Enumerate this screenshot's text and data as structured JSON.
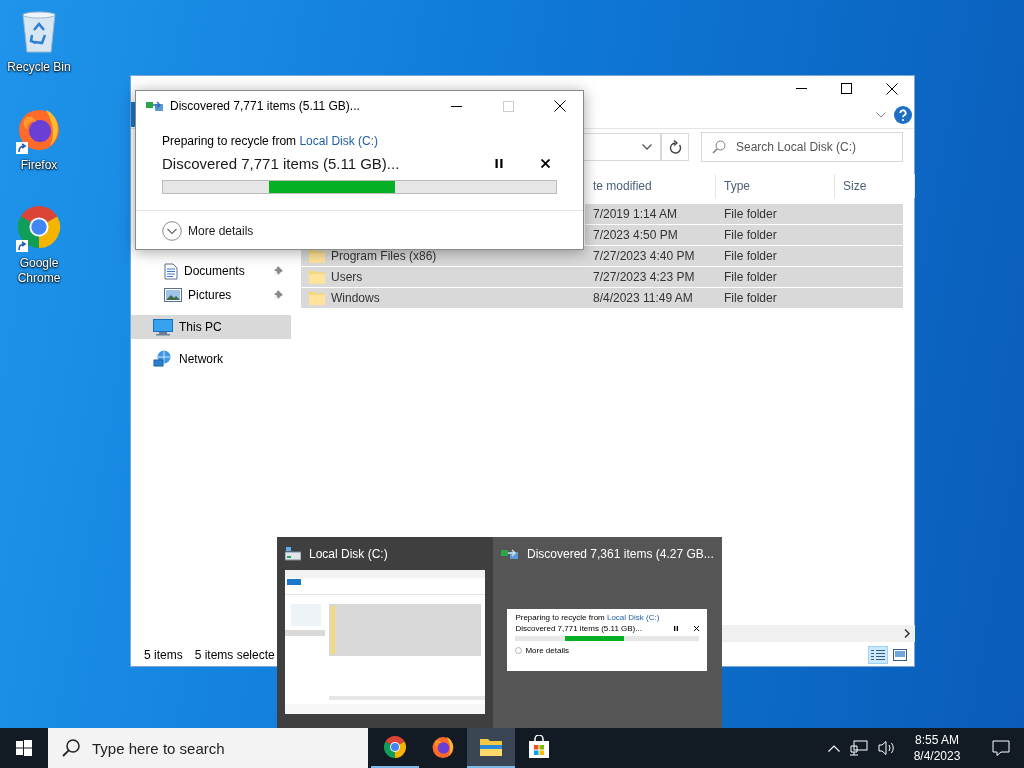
{
  "desktop_icons": [
    {
      "label": "Recycle Bin",
      "kind": "recycle"
    },
    {
      "label": "Firefox",
      "kind": "firefox"
    },
    {
      "label": "Google Chrome",
      "kind": "chrome"
    }
  ],
  "explorer": {
    "search": {
      "placeholder": "Search Local Disk (C:)"
    },
    "nav": [
      {
        "label": "Documents",
        "kind": "documents",
        "pinned": true,
        "selected": false
      },
      {
        "label": "Pictures",
        "kind": "pictures",
        "pinned": true,
        "selected": false
      },
      {
        "label": "This PC",
        "kind": "pc",
        "pinned": false,
        "selected": true
      },
      {
        "label": "Network",
        "kind": "network",
        "pinned": false,
        "selected": false
      }
    ],
    "columns": [
      "te modified",
      "Type",
      "Size"
    ],
    "rows": [
      {
        "date": "7/2019 1:14 AM",
        "type": "File folder",
        "selected": true
      },
      {
        "date": "7/2023 4:50 PM",
        "type": "File folder",
        "selected": true
      },
      {
        "name": "Program Files (x86)",
        "date": "7/27/2023 4:40 PM",
        "type": "File folder",
        "selected": true
      },
      {
        "name": "Users",
        "date": "7/27/2023 4:23 PM",
        "type": "File folder",
        "selected": true
      },
      {
        "name": "Windows",
        "date": "8/4/2023 11:49 AM",
        "type": "File folder",
        "selected": true
      }
    ],
    "status_bar": [
      "5 items",
      "5 items selecte"
    ],
    "view_buttons": [
      {
        "kind": "details",
        "selected": true
      },
      {
        "kind": "tiles",
        "selected": false
      }
    ]
  },
  "dialog": {
    "title": "Discovered 7,771 items (5.11 GB)...",
    "intro": "Preparing to recycle from",
    "source": "Local Disk (C:)",
    "status": "Discovered 7,771 items (5.11 GB)...",
    "progress": {
      "kind": "marquee"
    },
    "more_details": "More details"
  },
  "thumbnails": [
    {
      "title": "Local Disk (C:)",
      "kind": "explorer",
      "selected": false
    },
    {
      "title": "Discovered 7,361 items (4.27 GB...",
      "kind": "dialog",
      "selected": true,
      "preview": {
        "intro": "Preparing to recycle from",
        "source": "Local Disk (C:)",
        "status": "Discovered 7,771 items (5.11 GB)...",
        "more_details": "More details"
      }
    }
  ],
  "taskbar": {
    "search": {
      "placeholder": "Type here to search"
    },
    "apps": [
      {
        "kind": "chrome",
        "running": true,
        "active": false
      },
      {
        "kind": "firefox",
        "running": false,
        "active": false
      },
      {
        "kind": "explorer",
        "running": true,
        "active": true
      },
      {
        "kind": "store",
        "running": false,
        "active": false
      }
    ],
    "time": "8:55 AM",
    "date": "8/4/2023"
  }
}
